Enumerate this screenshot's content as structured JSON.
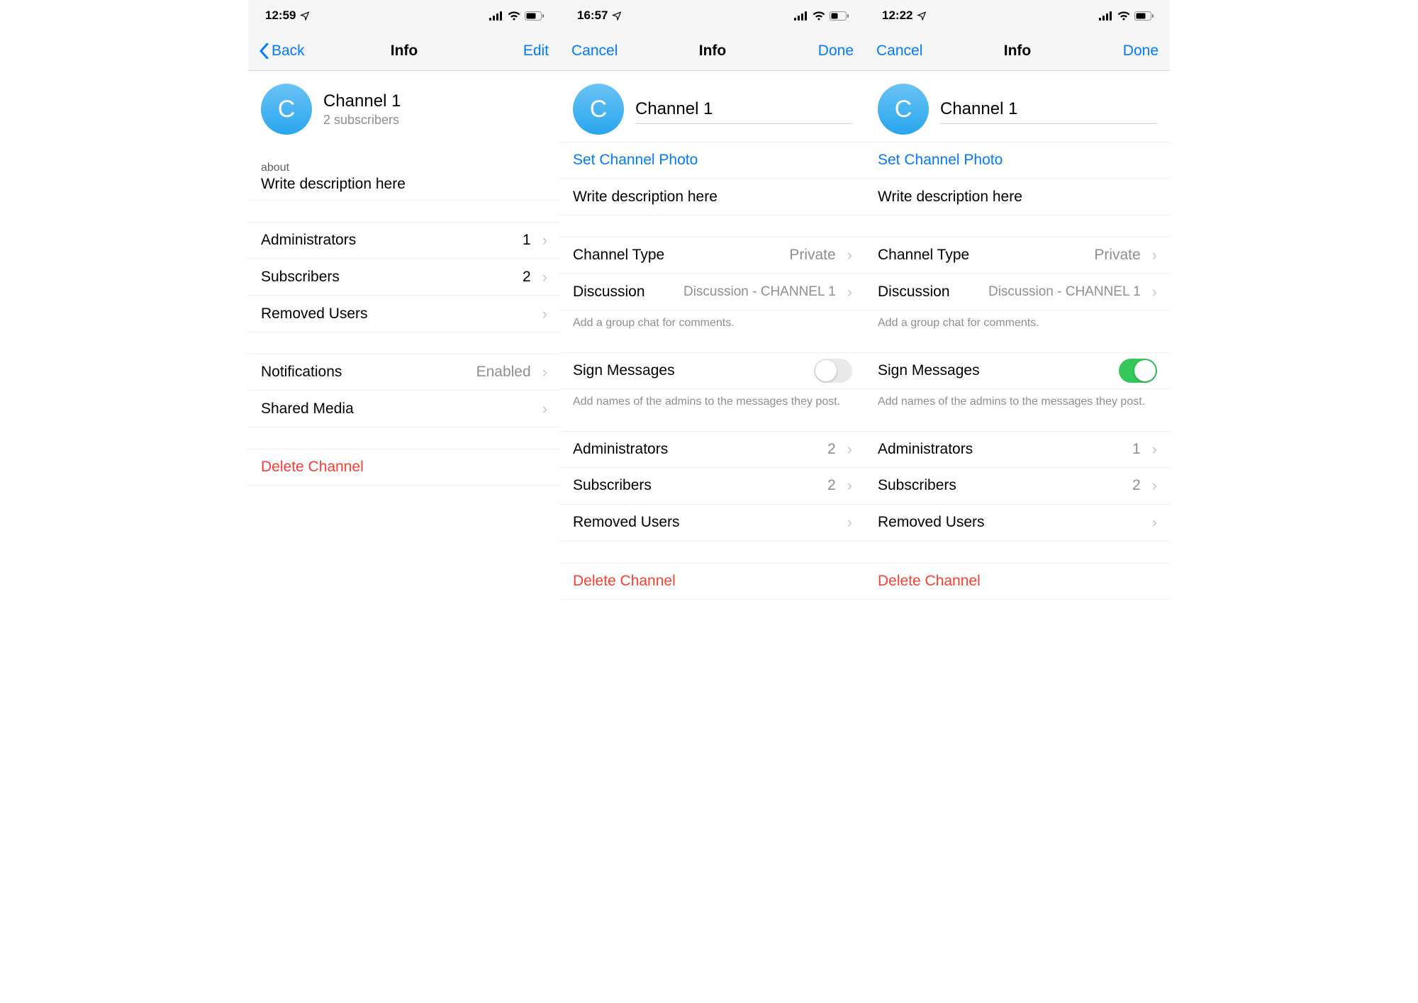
{
  "common": {
    "avatar_letter": "C",
    "channel_name": "Channel 1",
    "set_photo": "Set Channel Photo",
    "description_placeholder": "Write description here",
    "channel_type_label": "Channel Type",
    "channel_type_value": "Private",
    "discussion_label": "Discussion",
    "discussion_value": "Discussion - CHANNEL 1",
    "discussion_footer": "Add a group chat for comments.",
    "sign_label": "Sign Messages",
    "sign_footer": "Add names of the admins to the messages they post.",
    "admins_label": "Administrators",
    "subscribers_label": "Subscribers",
    "removed_label": "Removed Users",
    "delete_label": "Delete Channel",
    "notifications_label": "Notifications",
    "notifications_value": "Enabled",
    "shared_media_label": "Shared Media"
  },
  "screens": [
    {
      "time": "12:59",
      "nav_left": "Back",
      "nav_left_has_chevron": true,
      "nav_title": "Info",
      "nav_right": "Edit",
      "subscribers_line": "2 subscribers",
      "about_label": "about",
      "admins_count": "1",
      "subs_count": "2"
    },
    {
      "time": "16:57",
      "nav_left": "Cancel",
      "nav_title": "Info",
      "nav_right": "Done",
      "sign_on": false,
      "admins_count": "2",
      "subs_count": "2"
    },
    {
      "time": "12:22",
      "nav_left": "Cancel",
      "nav_title": "Info",
      "nav_right": "Done",
      "sign_on": true,
      "admins_count": "1",
      "subs_count": "2"
    }
  ]
}
